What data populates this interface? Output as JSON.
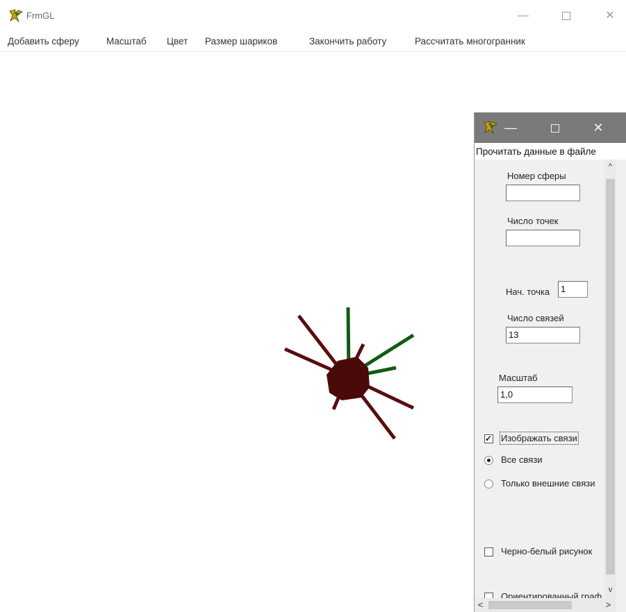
{
  "window": {
    "title": "FrmGL",
    "icon": "delphi-app-icon",
    "controls": {
      "minimize": "—",
      "maximize": "□",
      "close": "✕"
    }
  },
  "menu": [
    {
      "label": "Добавить сферу"
    },
    {
      "label": "Масштаб"
    },
    {
      "label": "Цвет"
    },
    {
      "label": "Размер шариков"
    },
    {
      "label": "Закончить работу"
    },
    {
      "label": "Рассчитать многогранник"
    }
  ],
  "scene": {
    "sphere_color": "#4a0a0a",
    "link_color_dark": "#5a0d0d",
    "link_color_green": "#0f5c14"
  },
  "panel": {
    "icon": "delphi-app-icon",
    "controls": {
      "minimize": "—",
      "maximize": "□",
      "close": "✕"
    },
    "menu_label": "Прочитать данные в файле",
    "sphere_number": {
      "label": "Номер сферы",
      "value": ""
    },
    "points_count": {
      "label": "Число точек",
      "value": ""
    },
    "start_point": {
      "label": "Нач. точка",
      "value": "1"
    },
    "links_count": {
      "label": "Число связей",
      "value": "13"
    },
    "scale": {
      "label": "Масштаб",
      "value": "1,0"
    },
    "show_links": {
      "label": "Изображать связи",
      "checked": true
    },
    "all_links": {
      "label": "Все связи",
      "selected": true
    },
    "external_links": {
      "label": "Только внешние связи",
      "selected": false
    },
    "bw_picture": {
      "label": "Черно-белый рисунок",
      "checked": false
    },
    "oriented_graph": {
      "label": "Ориентированный граф",
      "checked": false
    },
    "scroll_up": "^",
    "scroll_down": "v",
    "scroll_left": "<",
    "scroll_right": ">"
  }
}
